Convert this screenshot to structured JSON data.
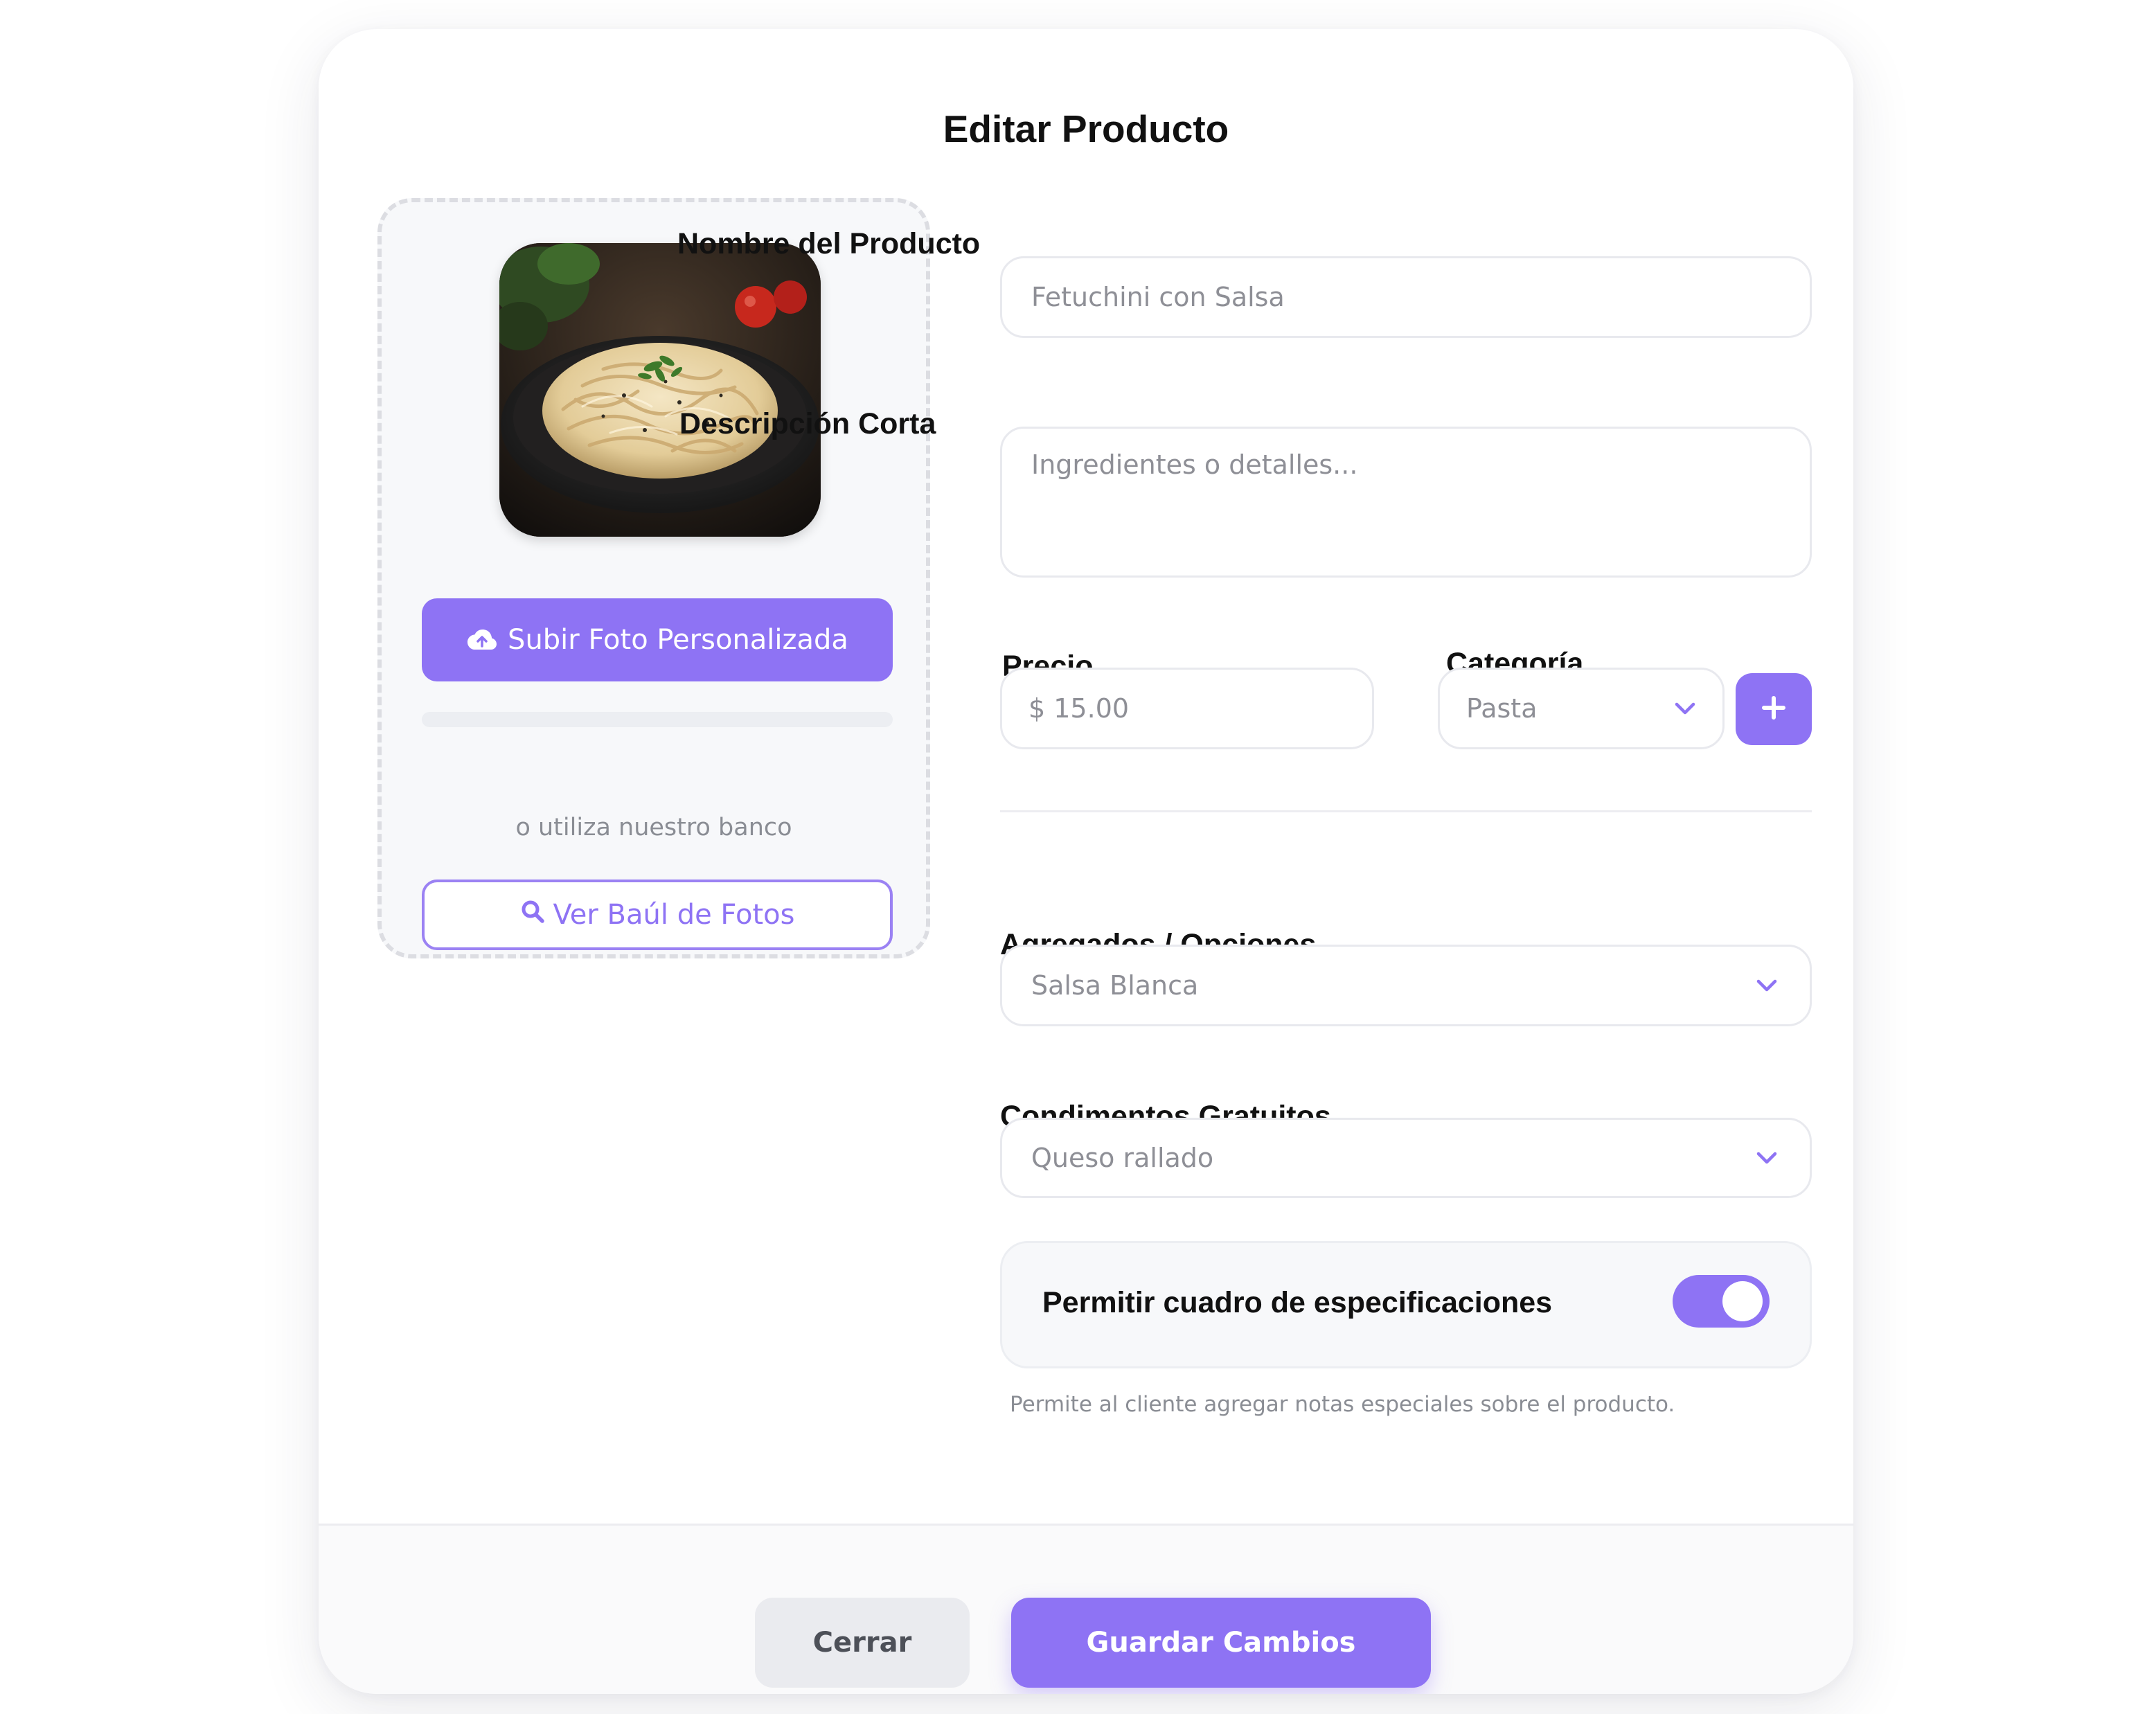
{
  "modal": {
    "title": "Editar Producto"
  },
  "photo_panel": {
    "image_alt": "Fetuchini con Salsa",
    "upload_button": "Subir Foto Personalizada",
    "upload_icon": "cloud-upload-icon",
    "upload_progress": 0,
    "bank_hint": "o utiliza nuestro banco",
    "bank_button": "Ver Baúl de Fotos",
    "bank_icon": "search-icon"
  },
  "form": {
    "name": {
      "label": "Nombre del Producto",
      "value": "Fetuchini con Salsa"
    },
    "description": {
      "label": "Descripción Corta",
      "placeholder": "Ingredientes o detalles...",
      "value": ""
    },
    "price": {
      "label": "Precio",
      "value": "$ 15.00"
    },
    "category": {
      "label": "Categoría",
      "selected": "Pasta",
      "add_icon": "plus-icon"
    },
    "addons": {
      "label": "Agregados / Opciones",
      "selected": "Salsa Blanca"
    },
    "condiments": {
      "label": "Condimentos Gratuitos",
      "selected": "Queso rallado"
    },
    "specs": {
      "label": "Permitir cuadro de especificaciones",
      "enabled": true,
      "helper": "Permite al cliente agregar notas especiales sobre el producto."
    }
  },
  "footer": {
    "cancel": "Cerrar",
    "save": "Guardar Cambios"
  },
  "colors": {
    "accent": "#8e73f4",
    "field_border": "#e8e9ee",
    "panel_bg": "#f7f8fa",
    "text_primary": "#111111",
    "text_muted": "#8e8f96"
  }
}
